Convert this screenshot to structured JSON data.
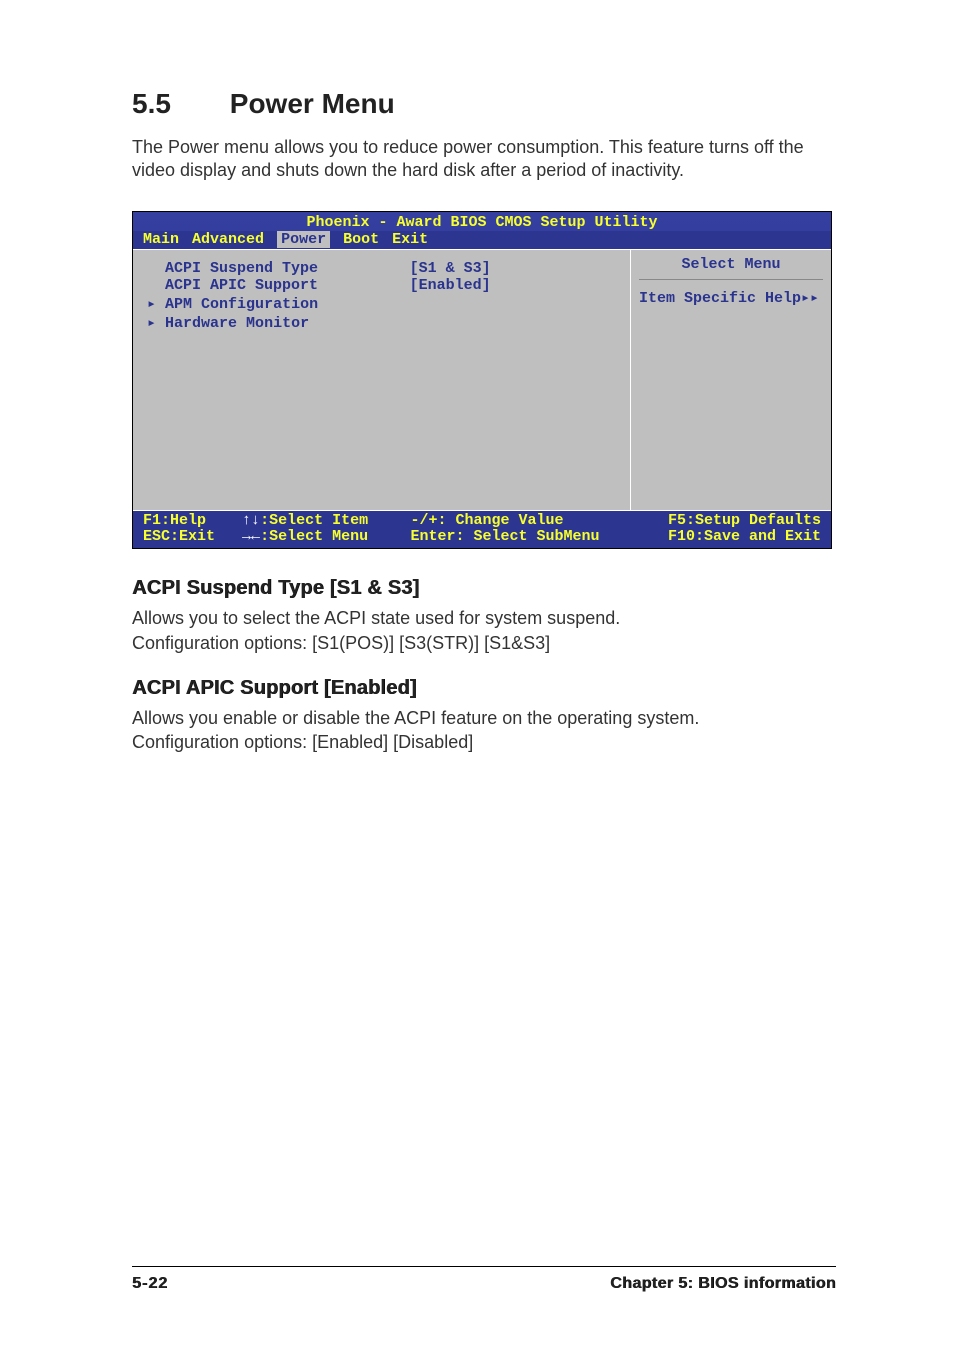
{
  "heading": {
    "number": "5.5",
    "title": "Power Menu"
  },
  "intro": "The Power menu allows you to reduce power consumption. This feature turns off the video display and shuts down the hard disk after a period of inactivity.",
  "bios": {
    "title": "Phoenix - Award BIOS CMOS Setup Utility",
    "tabs": [
      "Main",
      "Advanced",
      "Power",
      "Boot",
      "Exit"
    ],
    "active_tab_index": 2,
    "items": [
      {
        "label": "ACPI Suspend Type",
        "value": "[S1 & S3]",
        "submenu": false
      },
      {
        "label": "ACPI APIC Support",
        "value": "[Enabled]",
        "submenu": false
      },
      {
        "label": "APM Configuration",
        "value": "",
        "submenu": true
      },
      {
        "label": "Hardware Monitor",
        "value": "",
        "submenu": true
      }
    ],
    "right": {
      "heading": "Select Menu",
      "text": "Item Specific Help▸▸"
    },
    "footer": {
      "f1": "F1:Help",
      "esc": "ESC:Exit",
      "selitem": "↑↓:Select Item",
      "selmenu": "→←:Select Menu",
      "chval": "-/+: Change Value",
      "enter": "Enter: Select SubMenu",
      "f5": "F5:Setup Defaults",
      "f10": "F10:Save and Exit"
    }
  },
  "sub1": {
    "heading": "ACPI Suspend Type [S1 & S3]",
    "line1": "Allows you to select the ACPI state used for system suspend.",
    "line2": "Configuration options: [S1(POS)] [S3(STR)] [S1&S3]"
  },
  "sub2": {
    "heading": "ACPI APIC Support [Enabled]",
    "line1": "Allows you enable or disable the ACPI feature on the operating system.",
    "line2": "Configuration options: [Enabled] [Disabled]"
  },
  "footer": {
    "page": "5-22",
    "chapter": "Chapter 5: BIOS information"
  }
}
